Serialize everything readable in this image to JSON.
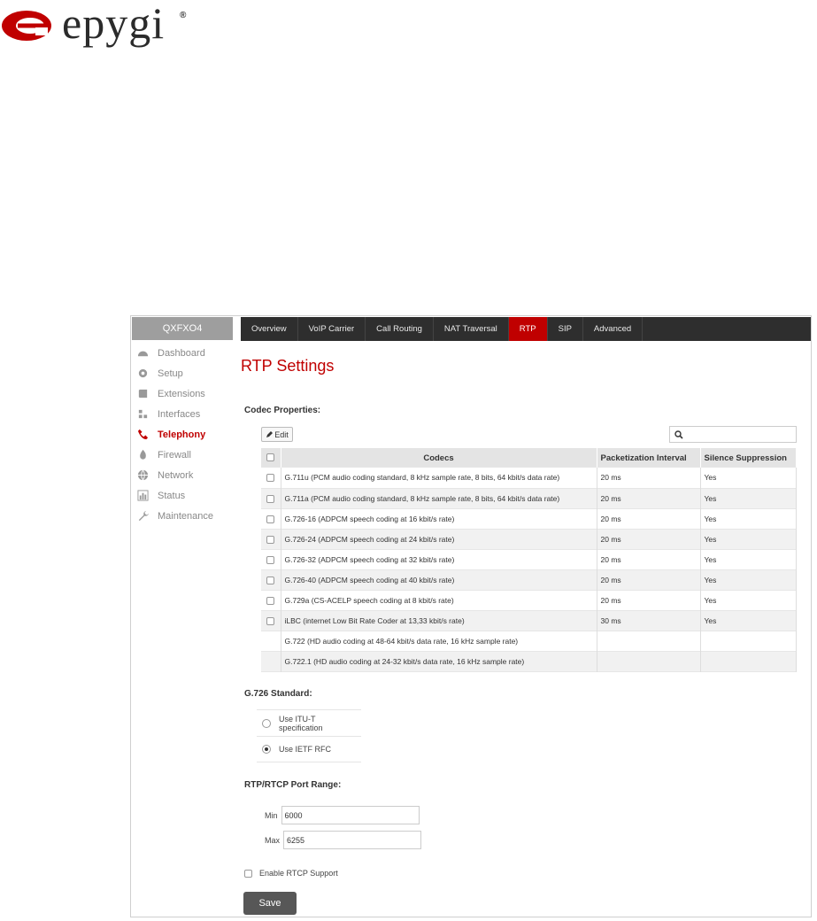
{
  "brand": {
    "name": "epygi",
    "registered": "®",
    "color": "#c00000"
  },
  "device": {
    "name": "QXFXO4"
  },
  "sidebar": {
    "items": [
      {
        "label": "Dashboard",
        "icon": "dashboard-icon",
        "active": false
      },
      {
        "label": "Setup",
        "icon": "gear-icon",
        "active": false
      },
      {
        "label": "Extensions",
        "icon": "book-icon",
        "active": false
      },
      {
        "label": "Interfaces",
        "icon": "sitemap-icon",
        "active": false
      },
      {
        "label": "Telephony",
        "icon": "phone-icon",
        "active": true
      },
      {
        "label": "Firewall",
        "icon": "fire-icon",
        "active": false
      },
      {
        "label": "Network",
        "icon": "globe-icon",
        "active": false
      },
      {
        "label": "Status",
        "icon": "bar-chart-icon",
        "active": false
      },
      {
        "label": "Maintenance",
        "icon": "wrench-icon",
        "active": false
      }
    ]
  },
  "topnav": {
    "tabs": [
      {
        "label": "Overview",
        "active": false
      },
      {
        "label": "VoIP Carrier",
        "active": false
      },
      {
        "label": "Call Routing",
        "active": false
      },
      {
        "label": "NAT Traversal",
        "active": false
      },
      {
        "label": "RTP",
        "active": true
      },
      {
        "label": "SIP",
        "active": false
      },
      {
        "label": "Advanced",
        "active": false
      }
    ]
  },
  "page": {
    "title": "RTP Settings"
  },
  "codec_section": {
    "title": "Codec Properties:",
    "edit_label": "Edit",
    "search_placeholder": "",
    "columns": {
      "codecs": "Codecs",
      "packetization": "Packetization Interval",
      "silence": "Silence Suppression"
    },
    "rows": [
      {
        "codec": "G.711u (PCM audio coding standard, 8 kHz sample rate, 8 bits, 64 kbit/s data rate)",
        "packetization": "20 ms",
        "silence": "Yes",
        "checkbox": true
      },
      {
        "codec": "G.711a (PCM audio coding standard, 8 kHz sample rate, 8 bits, 64 kbit/s data rate)",
        "packetization": "20 ms",
        "silence": "Yes",
        "checkbox": true
      },
      {
        "codec": "G.726-16 (ADPCM speech coding at 16 kbit/s rate)",
        "packetization": "20 ms",
        "silence": "Yes",
        "checkbox": true
      },
      {
        "codec": "G.726-24 (ADPCM speech coding at 24 kbit/s rate)",
        "packetization": "20 ms",
        "silence": "Yes",
        "checkbox": true
      },
      {
        "codec": "G.726-32 (ADPCM speech coding at 32 kbit/s rate)",
        "packetization": "20 ms",
        "silence": "Yes",
        "checkbox": true
      },
      {
        "codec": "G.726-40 (ADPCM speech coding at 40 kbit/s rate)",
        "packetization": "20 ms",
        "silence": "Yes",
        "checkbox": true
      },
      {
        "codec": "G.729a (CS-ACELP speech coding at 8 kbit/s rate)",
        "packetization": "20 ms",
        "silence": "Yes",
        "checkbox": true
      },
      {
        "codec": "iLBC (internet Low Bit Rate Coder at 13,33 kbit/s rate)",
        "packetization": "30 ms",
        "silence": "Yes",
        "checkbox": true
      },
      {
        "codec": "G.722 (HD audio coding at 48-64 kbit/s data rate, 16 kHz sample rate)",
        "packetization": "",
        "silence": "",
        "checkbox": false
      },
      {
        "codec": "G.722.1 (HD audio coding at 24-32 kbit/s data rate, 16 kHz sample rate)",
        "packetization": "",
        "silence": "",
        "checkbox": false
      }
    ]
  },
  "g726_section": {
    "title": "G.726 Standard:",
    "options": [
      {
        "label": "Use ITU-T specification",
        "checked": false
      },
      {
        "label": "Use IETF RFC",
        "checked": true
      }
    ]
  },
  "port_section": {
    "title": "RTP/RTCP Port Range:",
    "min_label": "Min",
    "min_value": "6000",
    "max_label": "Max",
    "max_value": "6255"
  },
  "rtcp": {
    "label": "Enable RTCP Support",
    "checked": false
  },
  "save_label": "Save"
}
